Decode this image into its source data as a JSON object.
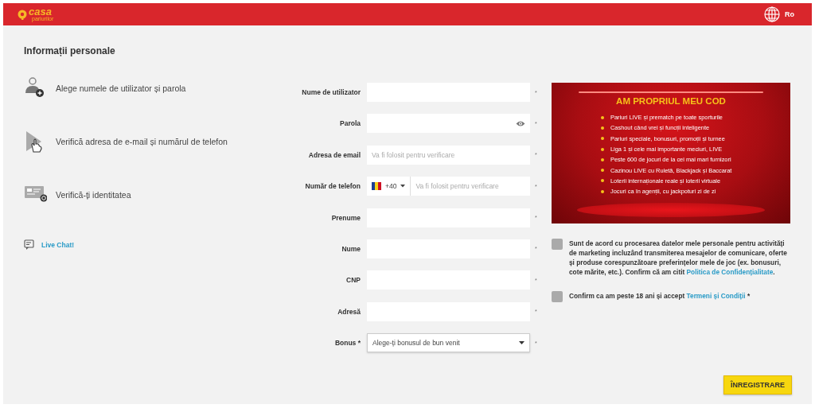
{
  "header": {
    "logo": {
      "name": "casa",
      "tagline": "pariurilor"
    },
    "language": "Ro"
  },
  "title": "Informații personale",
  "steps": [
    {
      "kind": "user",
      "label": "Alege numele de utilizator și parola"
    },
    {
      "kind": "pointer",
      "label": "Verifică adresa de e-mail și numărul de telefon"
    },
    {
      "kind": "card",
      "label": "Verifică-ți identitatea"
    }
  ],
  "live_chat": "Live Chat!",
  "form": {
    "fields": [
      {
        "kind": "text",
        "label": "Nume de utilizator",
        "mark": "*"
      },
      {
        "kind": "password",
        "label": "Parola",
        "mark": "*"
      },
      {
        "kind": "text",
        "label": "Adresa de email",
        "placeholder": "Va fi folosit pentru verificare",
        "mark": "*"
      },
      {
        "kind": "phone",
        "label": "Număr de telefon",
        "prefix": "+40",
        "placeholder": "Va fi folosit pentru verificare",
        "mark": "*"
      },
      {
        "kind": "text",
        "label": "Prenume",
        "mark": "*"
      },
      {
        "kind": "text",
        "label": "Nume",
        "mark": "*"
      },
      {
        "kind": "text",
        "label": "CNP",
        "mark": "*"
      },
      {
        "kind": "text",
        "label": "Adresă",
        "mark": "*"
      },
      {
        "kind": "select",
        "label": "Bonus *",
        "value": "Alege-ți bonusul de bun venit",
        "mark": "*"
      }
    ]
  },
  "promo": {
    "title": "AM PROPRIUL MEU COD",
    "items": [
      "Pariuri LIVE și prematch pe toate sporturile",
      "Cashout când vrei și funcții inteligente",
      "Pariuri speciale, bonusuri, promoții și turnee",
      "Liga 1 și cele mai importante meciuri, LIVE",
      "Peste 600 de jocuri de la cei mai mari furnizori",
      "Cazinou LIVE cu Ruletă, Blackjack și Baccarat",
      "Loterii internaționale reale și loterii virtuale",
      "Jocuri ca în agenții, cu jackpoturi zi de zi"
    ]
  },
  "consents": [
    {
      "checked": false,
      "text": "Sunt de acord cu procesarea datelor mele personale pentru activități de marketing incluzând transmiterea mesajelor de comunicare, oferte și produse corespunzătoare preferințelor mele de joc (ex. bonusuri, cote mărite, etc.). Confirm că am citit ",
      "link": "Politica de Confidențialitate",
      "suffix": "."
    },
    {
      "checked": false,
      "text": "Confirm ca am peste 18 ani și accept ",
      "link": "Termeni și Condiții",
      "suffix": " *"
    }
  ],
  "submit": "ÎNREGISTRARE"
}
